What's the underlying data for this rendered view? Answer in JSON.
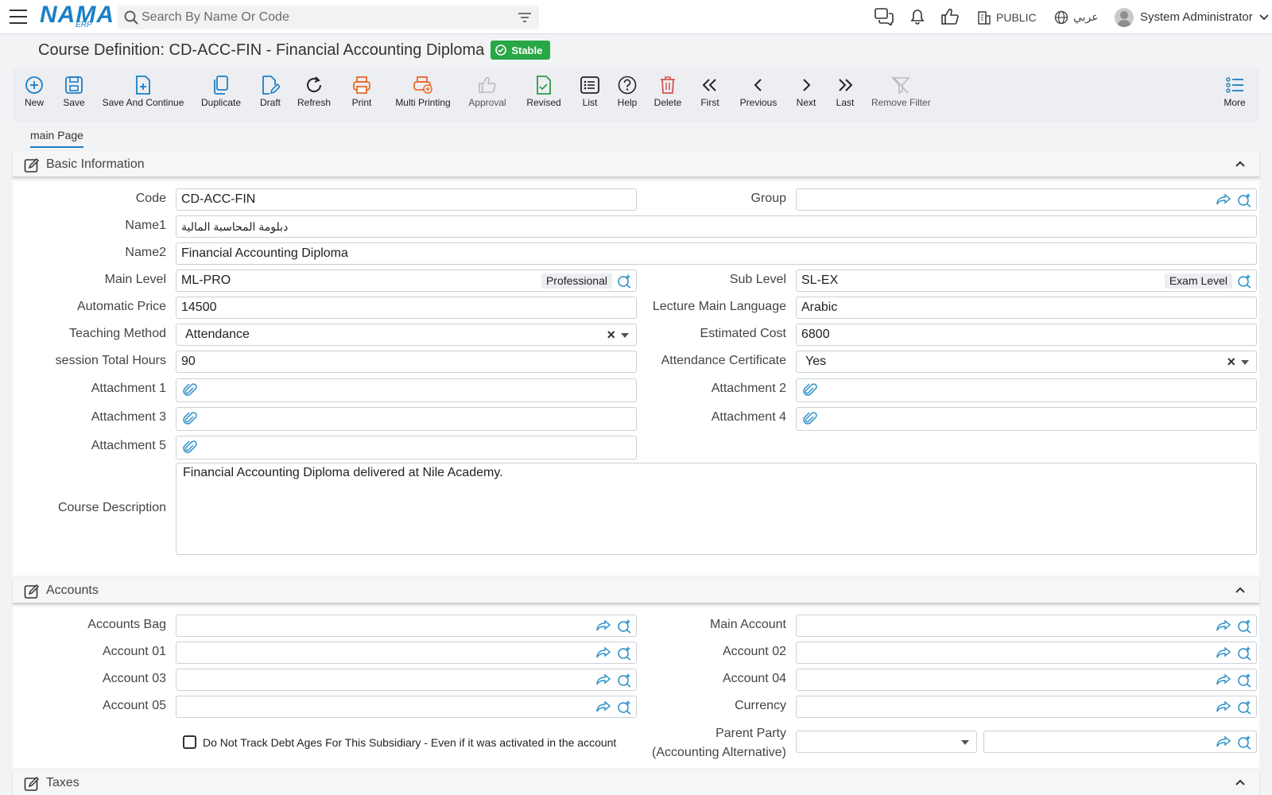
{
  "header": {
    "logo": "NAMA",
    "logo_sub": "ERP",
    "search_placeholder": "Search By Name Or Code",
    "public_label": "PUBLIC",
    "lang_label": "عربي",
    "user_name": "System Administrator"
  },
  "page": {
    "title": "Course Definition: CD-ACC-FIN - Financial Accounting Diploma",
    "status": "Stable"
  },
  "toolbar": {
    "new": "New",
    "save": "Save",
    "save_continue": "Save And Continue",
    "duplicate": "Duplicate",
    "draft": "Draft",
    "refresh": "Refresh",
    "print": "Print",
    "multi_printing": "Multi Printing",
    "approval": "Approval",
    "revised": "Revised",
    "list": "List",
    "help": "Help",
    "delete": "Delete",
    "first": "First",
    "previous": "Previous",
    "next": "Next",
    "last": "Last",
    "remove_filter": "Remove Filter",
    "more": "More"
  },
  "tabs": {
    "main": "main Page"
  },
  "basic": {
    "section_title": "Basic Information",
    "code_label": "Code",
    "code_value": "CD-ACC-FIN",
    "group_label": "Group",
    "group_value": "",
    "name1_label": "Name1",
    "name1_value": "دبلومة المحاسبة المالية",
    "name2_label": "Name2",
    "name2_value": "Financial Accounting Diploma",
    "main_level_label": "Main Level",
    "main_level_value": "ML-PRO",
    "main_level_tag": "Professional",
    "sub_level_label": "Sub Level",
    "sub_level_value": "SL-EX",
    "sub_level_tag": "Exam Level",
    "auto_price_label": "Automatic Price",
    "auto_price_value": "14500",
    "lecture_lang_label": "Lecture Main Language",
    "lecture_lang_value": "Arabic",
    "teaching_method_label": "Teaching Method",
    "teaching_method_value": "Attendance",
    "estimated_cost_label": "Estimated Cost",
    "estimated_cost_value": "6800",
    "session_hours_label": "session Total Hours",
    "session_hours_value": "90",
    "attendance_cert_label": "Attendance Certificate",
    "attendance_cert_value": "Yes",
    "attachment1_label": "Attachment 1",
    "attachment2_label": "Attachment 2",
    "attachment3_label": "Attachment 3",
    "attachment4_label": "Attachment 4",
    "attachment5_label": "Attachment 5",
    "description_label": "Course Description",
    "description_value": "Financial Accounting Diploma delivered at Nile Academy."
  },
  "accounts": {
    "section_title": "Accounts",
    "accounts_bag_label": "Accounts Bag",
    "main_account_label": "Main Account",
    "account01_label": "Account 01",
    "account02_label": "Account 02",
    "account03_label": "Account 03",
    "account04_label": "Account 04",
    "account05_label": "Account 05",
    "currency_label": "Currency",
    "debt_ages_label": "Do Not Track Debt Ages For This Subsidiary - Even if it was activated in the account",
    "parent_party_label_1": "Parent Party",
    "parent_party_label_2": "(Accounting Alternative)"
  },
  "taxes": {
    "section_title": "Taxes"
  },
  "colors": {
    "accent": "#1c7fc4",
    "success": "#28a745",
    "print": "#e8692c",
    "delete": "#d9534f",
    "link_icon": "#2b8fc7"
  }
}
